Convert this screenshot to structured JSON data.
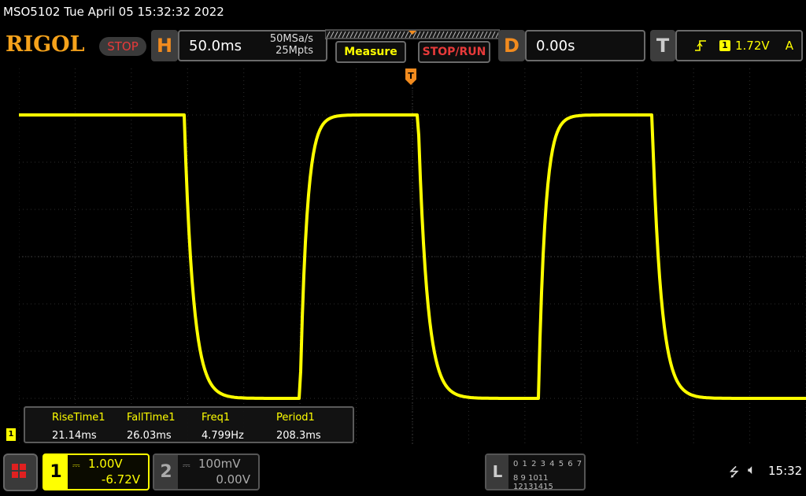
{
  "titlebar": {
    "text": "MSO5102  Tue April 05 15:32:32 2022"
  },
  "logo": "RIGOL",
  "run_state": "STOP",
  "horizontal": {
    "letter": "H",
    "timebase": "50.0ms",
    "sample_rate": "50MSa/s",
    "memory_depth": "25Mpts"
  },
  "buttons": {
    "measure": "Measure",
    "stop_run": "STOP/RUN"
  },
  "delay": {
    "letter": "D",
    "value": "0.00s"
  },
  "trigger": {
    "letter": "T",
    "edge_icon": "rising-edge-icon",
    "source": "1",
    "level": "1.72V",
    "mode": "A"
  },
  "trigger_position_marker": "T",
  "channel1_marker": "1",
  "measurements": [
    {
      "name": "RiseTime1",
      "value": "21.14ms"
    },
    {
      "name": "FallTime1",
      "value": "26.03ms"
    },
    {
      "name": "Freq1",
      "value": "4.799Hz"
    },
    {
      "name": "Period1",
      "value": "208.3ms"
    }
  ],
  "channels": [
    {
      "number": "1",
      "coupling": "DC",
      "scale": "1.00V",
      "offset": "-6.72V",
      "color": "#ffff00",
      "active": true
    },
    {
      "number": "2",
      "coupling": "DC",
      "scale": "100mV",
      "offset": "0.00V",
      "color": "#aaaaaa",
      "active": false
    }
  ],
  "logic": {
    "letter": "L",
    "row1": "0 1 2 3  4 5 6 7",
    "row2": "8 9 1011 12131415"
  },
  "status": {
    "usb_icon": "usb-icon",
    "speaker_icon": "speaker-muted-icon",
    "time": "15:32"
  },
  "colors": {
    "ch1": "#ffff00",
    "accent": "#f28b1e",
    "stop": "#e83a3a",
    "grid": "#3a3a3a"
  },
  "waveform": {
    "channel": "1",
    "shape": "square-rc",
    "levels_div": {
      "high": 3.0,
      "low": -3.0
    },
    "edges_ms": [
      {
        "type": "fall",
        "t": -203
      },
      {
        "type": "rise",
        "t": -100
      },
      {
        "type": "fall",
        "t": 5
      },
      {
        "type": "rise",
        "t": 112
      },
      {
        "type": "fall",
        "t": 213
      }
    ],
    "time_per_div_ms": 50,
    "screen_start_ms": -250
  }
}
